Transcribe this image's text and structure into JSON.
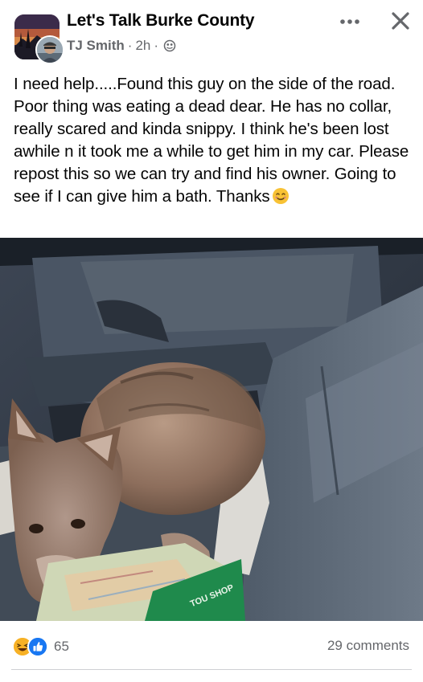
{
  "header": {
    "group_name": "Let's Talk Burke County",
    "author": "TJ Smith",
    "time": "2h",
    "separator": "·",
    "privacy_icon": "globe-icon",
    "more_icon": "more-horizontal-icon",
    "close_icon": "close-icon"
  },
  "post": {
    "text": "I need help.....Found this guy on the side of the road. Poor thing was eating a dead dear. He has no collar, really scared and kinda snippy. I think he's been lost awhile n it took me a while to get him in my car. Please repost this so we can try and find his owner. Going to see if I can give him a bath. Thanks",
    "emoji": "smiling-face-emoji",
    "photo": {
      "subject": "coyote-lying-on-car-seat",
      "bag_text": "TOU SHOP"
    }
  },
  "footer": {
    "reaction_icons": [
      "haha-icon",
      "like-icon"
    ],
    "reaction_count": "65",
    "comments": "29 comments"
  },
  "colors": {
    "text": "#050505",
    "secondary": "#65676b",
    "like_blue": "#1877f2",
    "haha_yellow": "#f7b125",
    "divider": "#ced0d4"
  }
}
